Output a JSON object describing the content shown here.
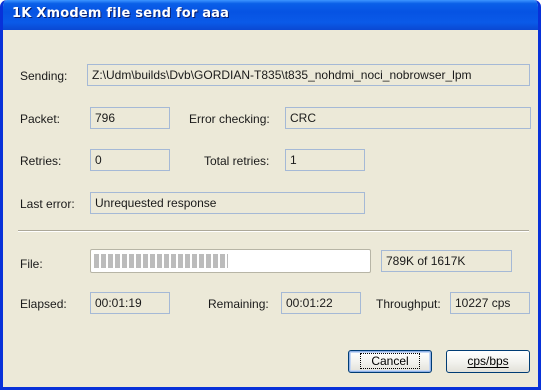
{
  "window": {
    "title": "1K Xmodem file send for aaa"
  },
  "sending": {
    "label": "Sending:",
    "value": "Z:\\Udm\\builds\\Dvb\\GORDIAN-T835\\t835_nohdmi_noci_nobrowser_lpm"
  },
  "packet": {
    "label": "Packet:",
    "value": "796"
  },
  "error_checking": {
    "label": "Error checking:",
    "value": "CRC"
  },
  "retries": {
    "label": "Retries:",
    "value": "0"
  },
  "total_retries": {
    "label": "Total retries:",
    "value": "1"
  },
  "last_error": {
    "label": "Last error:",
    "value": "Unrequested response"
  },
  "file": {
    "label": "File:",
    "progress_fraction": 0.49,
    "progress_text": "789K of 1617K"
  },
  "elapsed": {
    "label": "Elapsed:",
    "value": "00:01:19"
  },
  "remaining": {
    "label": "Remaining:",
    "value": "00:01:22"
  },
  "throughput": {
    "label": "Throughput:",
    "value": "10227 cps"
  },
  "buttons": {
    "cancel": "Cancel",
    "cps_bps": "cps/bps"
  },
  "colors": {
    "titlebar": "#0653e3",
    "dialog_bg": "#ece9d8",
    "field_border": "#a5b9d6"
  }
}
